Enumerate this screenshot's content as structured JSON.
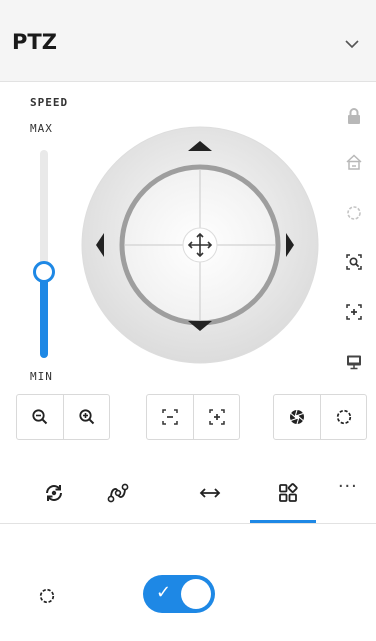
{
  "panel": {
    "title": "PTZ",
    "collapse_icon": "chevron-down-icon"
  },
  "speed": {
    "label": "SPEED",
    "max_label": "MAX",
    "min_label": "MIN",
    "level": 0.38
  },
  "joystick": {
    "center_icon": "move-icon",
    "directions": [
      "up",
      "down",
      "left",
      "right"
    ]
  },
  "side_controls": [
    {
      "name": "lock-icon"
    },
    {
      "name": "home-icon"
    },
    {
      "name": "loading-icon"
    },
    {
      "name": "zoom-region-icon"
    },
    {
      "name": "focus-region-icon"
    },
    {
      "name": "screen-icon"
    }
  ],
  "zoom_buttons": [
    {
      "name": "zoom-out-icon"
    },
    {
      "name": "zoom-in-icon"
    }
  ],
  "focus_buttons": [
    {
      "name": "focus-near-icon"
    },
    {
      "name": "focus-far-icon"
    }
  ],
  "iris_buttons": [
    {
      "name": "iris-close-icon"
    },
    {
      "name": "iris-open-icon"
    }
  ],
  "tabs": [
    {
      "name": "preset-icon"
    },
    {
      "name": "tour-icon"
    },
    {
      "name": "scan-icon"
    },
    {
      "name": "more-functions-icon",
      "active": true
    }
  ],
  "more_label": "...",
  "setting_row": {
    "icon": "loading-icon",
    "toggle_on": true,
    "toggle_glyph": "✓"
  },
  "colors": {
    "accent": "#1e88e5",
    "header_bg": "#f5f5f5"
  }
}
